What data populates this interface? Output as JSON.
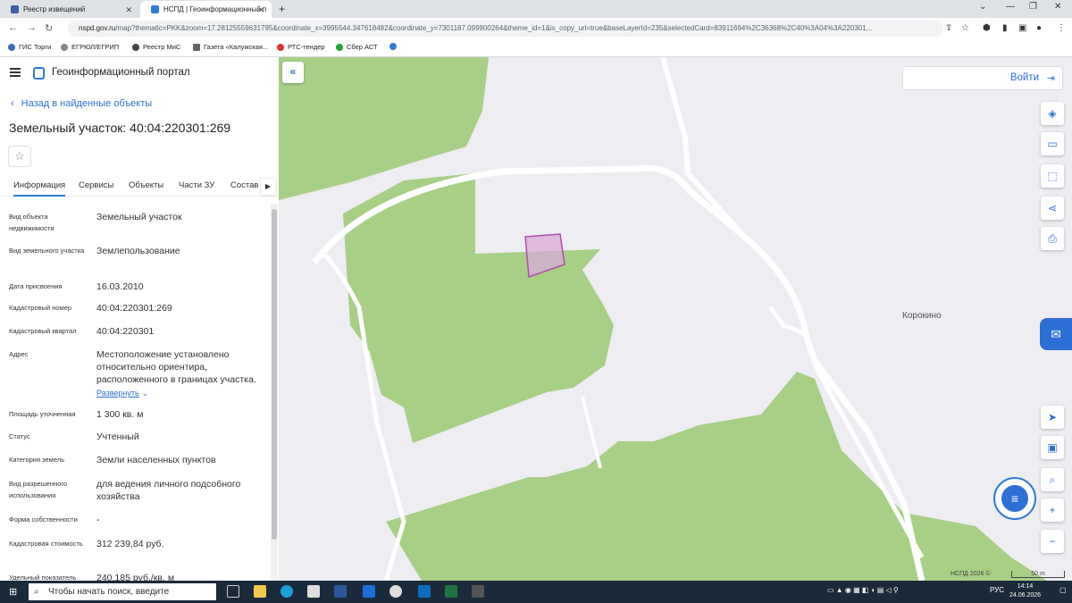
{
  "browser": {
    "tabs": [
      {
        "title": "Реестр извещений",
        "active": false
      },
      {
        "title": "НСПД | Геоинформационный п",
        "active": true
      }
    ],
    "new_tab_icon": "plus-icon",
    "url_host": "nspd.gov.ru",
    "url_rest": "/map?thematic=PKK&zoom=17.28125559631795&coordinate_x=3995544.347618482&coordinate_y=7301187.099900264&theme_id=1&is_copy_url=true&baseLayerId=235&selectedCard=83911694%2C36368%2C40%3A04%3A220301...",
    "bookmarks": [
      "ГИС Торги",
      "ЕГРЮЛ/ЕГРИП",
      "Реестр МиС",
      "Газета «Калужская...",
      "РТС-тендер",
      "Сбер АСТ"
    ]
  },
  "panel": {
    "portal_title": "Геоинформационный портал",
    "back_label": "Назад в найденные объекты",
    "object_title": "Земельный участок: 40:04:220301:269",
    "tabs": [
      "Информация",
      "Сервисы",
      "Объекты",
      "Части ЗУ",
      "Состав"
    ],
    "properties": [
      {
        "label": "Вид объекта недвижимости",
        "value": "Земельный участок"
      },
      {
        "label": "Вид земельного участка",
        "value": "Землепользование"
      },
      {
        "label": "Дата присвоения",
        "value": "16.03.2010"
      },
      {
        "label": "Кадастровый номер",
        "value": "40:04:220301:269"
      },
      {
        "label": "Кадастровый квартал",
        "value": "40:04:220301"
      },
      {
        "label": "Адрес",
        "value": "Местоположение установлено относительно ориентира, расположенного в границах участка."
      },
      {
        "label": "Площадь уточненная",
        "value": "1 300 кв. м"
      },
      {
        "label": "Статус",
        "value": "Учтенный"
      },
      {
        "label": "Категория земель",
        "value": "Земли населенных пунктов"
      },
      {
        "label": "Вид разрешенного использования",
        "value": "для ведения личного подсобного хозяйства"
      },
      {
        "label": "Форма собственности",
        "value": "-"
      },
      {
        "label": "Кадастровая стоимость",
        "value": "312 239,84 руб."
      },
      {
        "label": "Удельный показатель",
        "value": "240,185 руб./кв. м"
      }
    ],
    "expand_label": "Развернуть"
  },
  "map": {
    "login_label": "Войти",
    "place_label": "Корокино",
    "copyright": "НСПД 2026 ©",
    "scale_label": "50 m",
    "colors": {
      "forest": "#a7cf85",
      "road": "#ffffff",
      "background": "#eeedf2",
      "parcel": "#b44bb0"
    }
  },
  "taskbar": {
    "search_placeholder": "Чтобы начать поиск, введите",
    "language": "РУС",
    "time": "14:14",
    "date": "24.06.2026"
  }
}
